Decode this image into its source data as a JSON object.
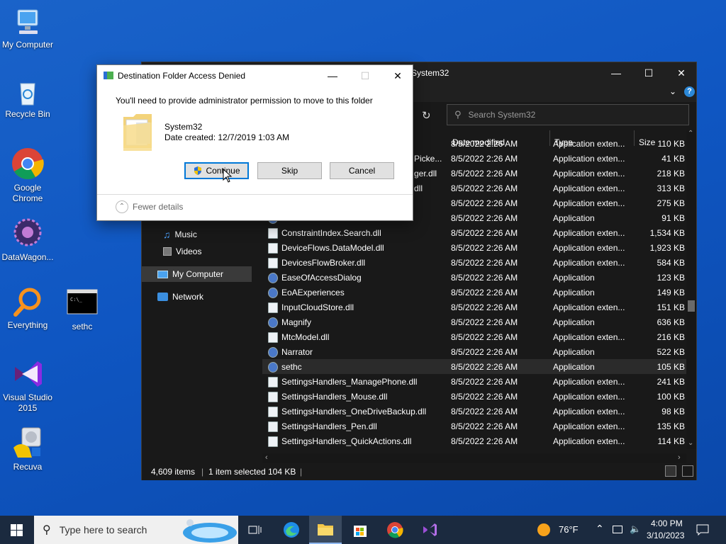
{
  "desktop": {
    "icons": [
      {
        "label": "My Computer"
      },
      {
        "label": "Recycle Bin"
      },
      {
        "label": "Google Chrome"
      },
      {
        "label": "DataWagon..."
      },
      {
        "label": "Everything"
      },
      {
        "label": "sethc"
      },
      {
        "label": "Visual Studio 2015"
      },
      {
        "label": "Recuva"
      }
    ]
  },
  "explorer": {
    "title": "System32",
    "search_placeholder": "Search System32",
    "columns": [
      "Date modified",
      "Type",
      "Size"
    ],
    "nav": [
      {
        "label": "Music",
        "icon": "music-icon"
      },
      {
        "label": "Videos",
        "icon": "video-icon"
      },
      {
        "label": "My Computer",
        "icon": "computer-icon"
      },
      {
        "label": "Network",
        "icon": "network-icon"
      }
    ],
    "rows": [
      {
        "name": "",
        "date": "8/5/2022 2:26 AM",
        "type": "Application exten...",
        "size": "110 KB"
      },
      {
        "name": "Picke...",
        "date": "8/5/2022 2:26 AM",
        "type": "Application exten...",
        "size": "41 KB"
      },
      {
        "name": "ger.dll",
        "date": "8/5/2022 2:26 AM",
        "type": "Application exten...",
        "size": "218 KB"
      },
      {
        "name": "dll",
        "date": "8/5/2022 2:26 AM",
        "type": "Application exten...",
        "size": "313 KB"
      },
      {
        "name": "",
        "date": "8/5/2022 2:26 AM",
        "type": "Application exten...",
        "size": "275 KB"
      },
      {
        "name": "AtBroker",
        "date": "8/5/2022 2:26 AM",
        "type": "Application",
        "size": "91 KB"
      },
      {
        "name": "ConstraintIndex.Search.dll",
        "date": "8/5/2022 2:26 AM",
        "type": "Application exten...",
        "size": "1,534 KB"
      },
      {
        "name": "DeviceFlows.DataModel.dll",
        "date": "8/5/2022 2:26 AM",
        "type": "Application exten...",
        "size": "1,923 KB"
      },
      {
        "name": "DevicesFlowBroker.dll",
        "date": "8/5/2022 2:26 AM",
        "type": "Application exten...",
        "size": "584 KB"
      },
      {
        "name": "EaseOfAccessDialog",
        "date": "8/5/2022 2:26 AM",
        "type": "Application",
        "size": "123 KB"
      },
      {
        "name": "EoAExperiences",
        "date": "8/5/2022 2:26 AM",
        "type": "Application",
        "size": "149 KB"
      },
      {
        "name": "InputCloudStore.dll",
        "date": "8/5/2022 2:26 AM",
        "type": "Application exten...",
        "size": "151 KB"
      },
      {
        "name": "Magnify",
        "date": "8/5/2022 2:26 AM",
        "type": "Application",
        "size": "636 KB"
      },
      {
        "name": "MtcModel.dll",
        "date": "8/5/2022 2:26 AM",
        "type": "Application exten...",
        "size": "216 KB"
      },
      {
        "name": "Narrator",
        "date": "8/5/2022 2:26 AM",
        "type": "Application",
        "size": "522 KB"
      },
      {
        "name": "sethc",
        "date": "8/5/2022 2:26 AM",
        "type": "Application",
        "size": "105 KB"
      },
      {
        "name": "SettingsHandlers_ManagePhone.dll",
        "date": "8/5/2022 2:26 AM",
        "type": "Application exten...",
        "size": "241 KB"
      },
      {
        "name": "SettingsHandlers_Mouse.dll",
        "date": "8/5/2022 2:26 AM",
        "type": "Application exten...",
        "size": "100 KB"
      },
      {
        "name": "SettingsHandlers_OneDriveBackup.dll",
        "date": "8/5/2022 2:26 AM",
        "type": "Application exten...",
        "size": "98 KB"
      },
      {
        "name": "SettingsHandlers_Pen.dll",
        "date": "8/5/2022 2:26 AM",
        "type": "Application exten...",
        "size": "135 KB"
      },
      {
        "name": "SettingsHandlers_QuickActions.dll",
        "date": "8/5/2022 2:26 AM",
        "type": "Application exten...",
        "size": "114 KB"
      }
    ],
    "status": {
      "items": "4,609 items",
      "selected": "1 item selected",
      "size": "104 KB"
    }
  },
  "dialog": {
    "title": "Destination Folder Access Denied",
    "message": "You'll need to provide administrator permission to move to this folder",
    "folder_name": "System32",
    "folder_date": "Date created: 12/7/2019 1:03 AM",
    "buttons": {
      "continue": "Continue",
      "skip": "Skip",
      "cancel": "Cancel"
    },
    "fewer_details": "Fewer details"
  },
  "taskbar": {
    "search_placeholder": "Type here to search",
    "weather": "76°F",
    "time": "4:00 PM",
    "date": "3/10/2023"
  },
  "colors": {
    "accent": "#0078d7",
    "taskbar": "#1b2a3f",
    "explorer_bg": "#191919"
  }
}
